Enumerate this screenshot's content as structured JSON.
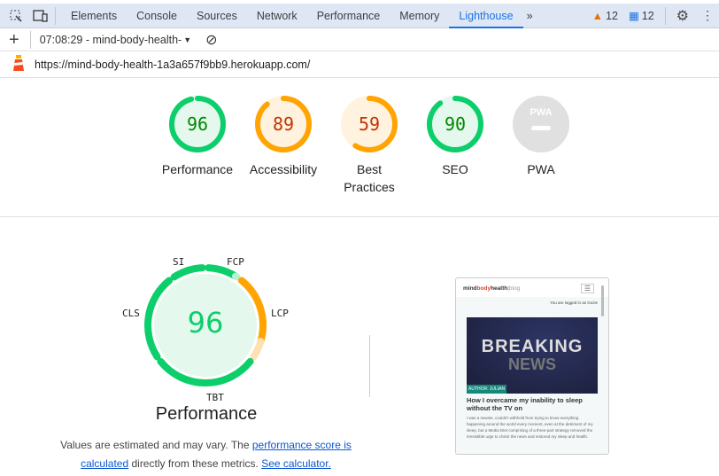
{
  "devtools": {
    "tabs": [
      "Elements",
      "Console",
      "Sources",
      "Network",
      "Performance",
      "Memory",
      "Lighthouse"
    ],
    "active_tab": "Lighthouse",
    "warnings": "12",
    "messages": "12",
    "report_select": "07:08:29 - mind-body-health-",
    "url": "https://mind-body-health-1a3a657f9bb9.herokuapp.com/"
  },
  "categories": [
    {
      "label": "Performance",
      "score": "96",
      "value": 96,
      "color": "#0cce6b",
      "text": "#008800",
      "bg": "#e5f8ed"
    },
    {
      "label": "Accessibility",
      "score": "89",
      "value": 89,
      "color": "#ffa400",
      "text": "#c33300",
      "bg": "#fff3e0"
    },
    {
      "label": "Best Practices",
      "score": "59",
      "value": 59,
      "color": "#ffa400",
      "text": "#c33300",
      "bg": "#fff3e0"
    },
    {
      "label": "SEO",
      "score": "90",
      "value": 90,
      "color": "#0cce6b",
      "text": "#008800",
      "bg": "#e5f8ed"
    },
    {
      "label": "PWA",
      "score": "PWA",
      "value": null,
      "color": "#ccc",
      "text": "#fff",
      "bg": "#e0e0e0"
    }
  ],
  "performance": {
    "score": "96",
    "title": "Performance",
    "metrics": [
      {
        "label": "FCP",
        "weight": 10,
        "score": 0.95
      },
      {
        "label": "LCP",
        "weight": 25,
        "score": 0.8
      },
      {
        "label": "TBT",
        "weight": 30,
        "score": 1
      },
      {
        "label": "CLS",
        "weight": 25,
        "score": 1
      },
      {
        "label": "SI",
        "weight": 10,
        "score": 1
      }
    ],
    "note_1": "Values are estimated and may vary. The ",
    "note_link1": "performance score is calculated",
    "note_2": " directly from these metrics. ",
    "note_link2": "See calculator."
  },
  "screenshot": {
    "brand_1": "mind",
    "brand_2": "body",
    "brand_3": "health",
    "brand_4": "|blog",
    "logged_in": "You are logged in as Gozie",
    "image_line1": "BREAKING",
    "image_line2": "NEWS",
    "author": "AUTHOR: JULIAN",
    "post_title": "How I overcame my inability to sleep without the TV on",
    "excerpt": "I was a newsie, couldn't withhold from trying to know everything happening around the world every moment, even at the detriment of my sleep, but a Media Diet comprising of a three-part strategy removed the irresistible urge to check the news and restored my sleep and health."
  }
}
